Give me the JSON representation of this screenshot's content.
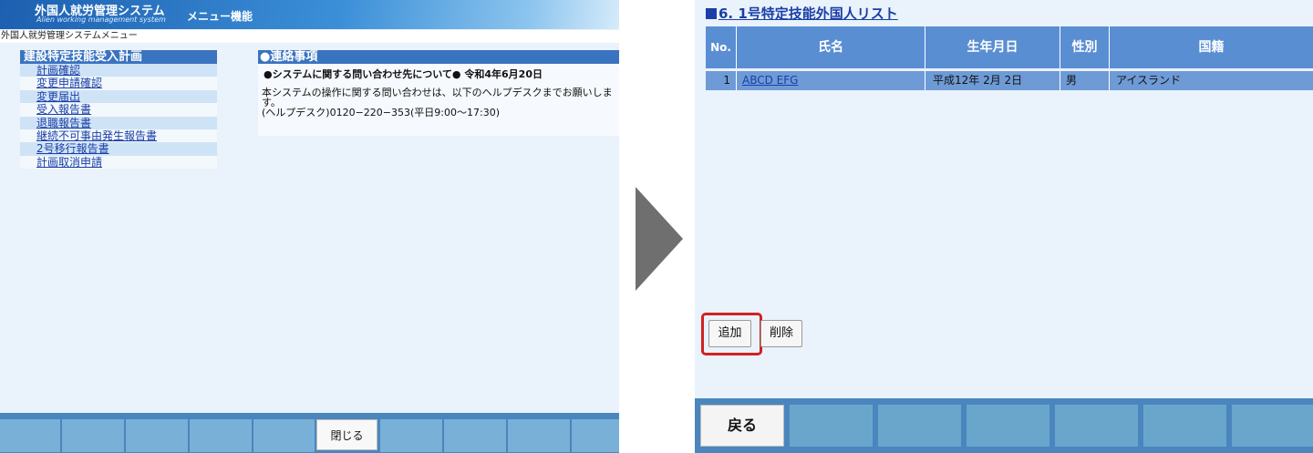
{
  "left_screen": {
    "header": {
      "title": "外国人就労管理システム",
      "subtitle": "Alien working management system",
      "section": "メニュー機能"
    },
    "breadcrumb": "外国人就労管理システムメニュー",
    "menu": {
      "heading": "建設特定技能受入計画",
      "items": [
        {
          "label": "計画確認"
        },
        {
          "label": "変更申請確認"
        },
        {
          "label": "変更届出"
        },
        {
          "label": "受入報告書"
        },
        {
          "label": "退職報告書"
        },
        {
          "label": "継続不可事由発生報告書"
        },
        {
          "label": "2号移行報告書"
        },
        {
          "label": "計画取消申請"
        }
      ]
    },
    "notice": {
      "heading": "●連絡事項",
      "subject": "●システムに関する問い合わせ先について● 令和4年6月20日",
      "line1": "本システムの操作に関する問い合わせは、以下のヘルプデスクまでお願いしま",
      "line2": "す。",
      "line3": "(ヘルプデスク)0120−220−353(平日9:00〜17:30)"
    },
    "footer": {
      "close_label": "閉じる"
    }
  },
  "right_screen": {
    "title": "6. 1号特定技能外国人リスト",
    "table": {
      "headers": [
        "No.",
        "氏名",
        "生年月日",
        "性別",
        "国籍"
      ],
      "rows": [
        {
          "no": "1",
          "name": "ABCD EFG",
          "dob": "平成12年 2月 2日",
          "sex": "男",
          "nationality": "アイスランド"
        }
      ]
    },
    "buttons": {
      "add_label": "追加",
      "delete_label": "削除"
    },
    "footer": {
      "back_label": "戻る"
    }
  },
  "colors": {
    "header_blue": "#1d5fb0",
    "table_header": "#5a8ed3",
    "highlight_red": "#d32020",
    "footer_blue": "#4a86bd",
    "arrow_gray": "#6f6f6f"
  }
}
